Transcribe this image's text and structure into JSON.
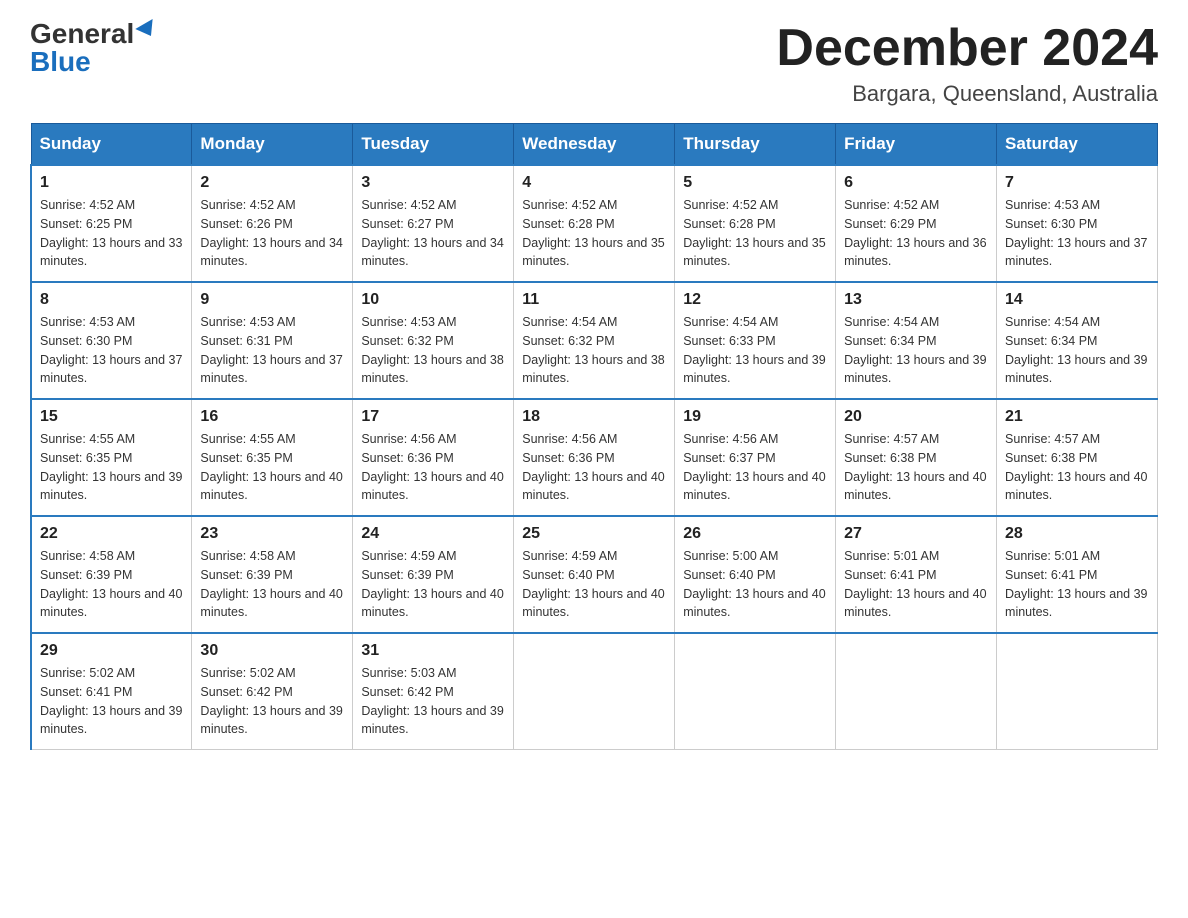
{
  "header": {
    "logo_general": "General",
    "logo_blue": "Blue",
    "month_title": "December 2024",
    "location": "Bargara, Queensland, Australia"
  },
  "days_of_week": [
    "Sunday",
    "Monday",
    "Tuesday",
    "Wednesday",
    "Thursday",
    "Friday",
    "Saturday"
  ],
  "weeks": [
    [
      {
        "day": "1",
        "sunrise": "4:52 AM",
        "sunset": "6:25 PM",
        "daylight": "13 hours and 33 minutes."
      },
      {
        "day": "2",
        "sunrise": "4:52 AM",
        "sunset": "6:26 PM",
        "daylight": "13 hours and 34 minutes."
      },
      {
        "day": "3",
        "sunrise": "4:52 AM",
        "sunset": "6:27 PM",
        "daylight": "13 hours and 34 minutes."
      },
      {
        "day": "4",
        "sunrise": "4:52 AM",
        "sunset": "6:28 PM",
        "daylight": "13 hours and 35 minutes."
      },
      {
        "day": "5",
        "sunrise": "4:52 AM",
        "sunset": "6:28 PM",
        "daylight": "13 hours and 35 minutes."
      },
      {
        "day": "6",
        "sunrise": "4:52 AM",
        "sunset": "6:29 PM",
        "daylight": "13 hours and 36 minutes."
      },
      {
        "day": "7",
        "sunrise": "4:53 AM",
        "sunset": "6:30 PM",
        "daylight": "13 hours and 37 minutes."
      }
    ],
    [
      {
        "day": "8",
        "sunrise": "4:53 AM",
        "sunset": "6:30 PM",
        "daylight": "13 hours and 37 minutes."
      },
      {
        "day": "9",
        "sunrise": "4:53 AM",
        "sunset": "6:31 PM",
        "daylight": "13 hours and 37 minutes."
      },
      {
        "day": "10",
        "sunrise": "4:53 AM",
        "sunset": "6:32 PM",
        "daylight": "13 hours and 38 minutes."
      },
      {
        "day": "11",
        "sunrise": "4:54 AM",
        "sunset": "6:32 PM",
        "daylight": "13 hours and 38 minutes."
      },
      {
        "day": "12",
        "sunrise": "4:54 AM",
        "sunset": "6:33 PM",
        "daylight": "13 hours and 39 minutes."
      },
      {
        "day": "13",
        "sunrise": "4:54 AM",
        "sunset": "6:34 PM",
        "daylight": "13 hours and 39 minutes."
      },
      {
        "day": "14",
        "sunrise": "4:54 AM",
        "sunset": "6:34 PM",
        "daylight": "13 hours and 39 minutes."
      }
    ],
    [
      {
        "day": "15",
        "sunrise": "4:55 AM",
        "sunset": "6:35 PM",
        "daylight": "13 hours and 39 minutes."
      },
      {
        "day": "16",
        "sunrise": "4:55 AM",
        "sunset": "6:35 PM",
        "daylight": "13 hours and 40 minutes."
      },
      {
        "day": "17",
        "sunrise": "4:56 AM",
        "sunset": "6:36 PM",
        "daylight": "13 hours and 40 minutes."
      },
      {
        "day": "18",
        "sunrise": "4:56 AM",
        "sunset": "6:36 PM",
        "daylight": "13 hours and 40 minutes."
      },
      {
        "day": "19",
        "sunrise": "4:56 AM",
        "sunset": "6:37 PM",
        "daylight": "13 hours and 40 minutes."
      },
      {
        "day": "20",
        "sunrise": "4:57 AM",
        "sunset": "6:38 PM",
        "daylight": "13 hours and 40 minutes."
      },
      {
        "day": "21",
        "sunrise": "4:57 AM",
        "sunset": "6:38 PM",
        "daylight": "13 hours and 40 minutes."
      }
    ],
    [
      {
        "day": "22",
        "sunrise": "4:58 AM",
        "sunset": "6:39 PM",
        "daylight": "13 hours and 40 minutes."
      },
      {
        "day": "23",
        "sunrise": "4:58 AM",
        "sunset": "6:39 PM",
        "daylight": "13 hours and 40 minutes."
      },
      {
        "day": "24",
        "sunrise": "4:59 AM",
        "sunset": "6:39 PM",
        "daylight": "13 hours and 40 minutes."
      },
      {
        "day": "25",
        "sunrise": "4:59 AM",
        "sunset": "6:40 PM",
        "daylight": "13 hours and 40 minutes."
      },
      {
        "day": "26",
        "sunrise": "5:00 AM",
        "sunset": "6:40 PM",
        "daylight": "13 hours and 40 minutes."
      },
      {
        "day": "27",
        "sunrise": "5:01 AM",
        "sunset": "6:41 PM",
        "daylight": "13 hours and 40 minutes."
      },
      {
        "day": "28",
        "sunrise": "5:01 AM",
        "sunset": "6:41 PM",
        "daylight": "13 hours and 39 minutes."
      }
    ],
    [
      {
        "day": "29",
        "sunrise": "5:02 AM",
        "sunset": "6:41 PM",
        "daylight": "13 hours and 39 minutes."
      },
      {
        "day": "30",
        "sunrise": "5:02 AM",
        "sunset": "6:42 PM",
        "daylight": "13 hours and 39 minutes."
      },
      {
        "day": "31",
        "sunrise": "5:03 AM",
        "sunset": "6:42 PM",
        "daylight": "13 hours and 39 minutes."
      },
      null,
      null,
      null,
      null
    ]
  ]
}
